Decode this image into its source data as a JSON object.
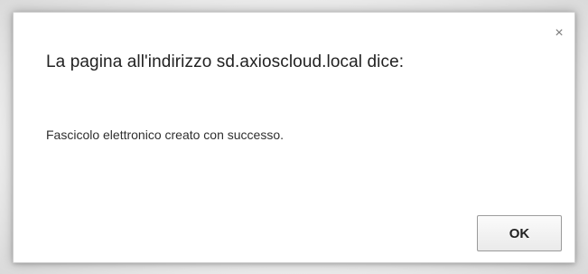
{
  "dialog": {
    "title": "La pagina all'indirizzo sd.axioscloud.local dice:",
    "message": "Fascicolo elettronico creato con successo.",
    "ok_label": "OK",
    "close_glyph": "×",
    "close_icon": "close-icon"
  }
}
